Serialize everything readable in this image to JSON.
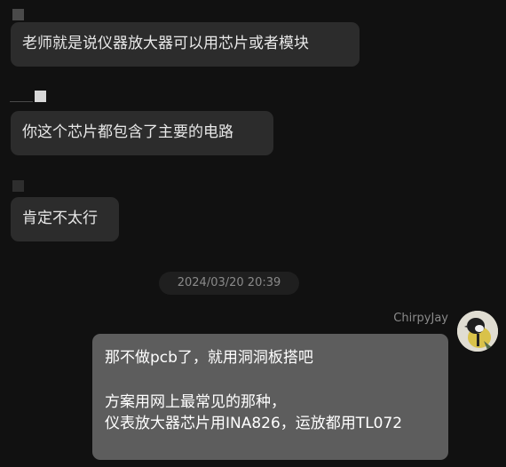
{
  "conversation": {
    "incoming": [
      {
        "text": "老师就是说仪器放大器可以用芯片或者模块"
      },
      {
        "text": "你这个芯片都包含了主要的电路"
      },
      {
        "text": "肯定不太行"
      }
    ],
    "timestamp": "2024/03/20 20:39",
    "outgoing": {
      "sender_name": "ChirpyJay",
      "avatar_icon": "bird-avatar",
      "lines": [
        "那不做pcb了，就用洞洞板搭吧",
        "方案用网上最常见的那种，",
        "仪表放大器芯片用INA826，运放都用TL072"
      ]
    }
  },
  "colors": {
    "background": "#111111",
    "incoming_bubble": "#2c2c2c",
    "outgoing_bubble": "#5d5d5d",
    "muted_text": "#8a8a8a"
  }
}
